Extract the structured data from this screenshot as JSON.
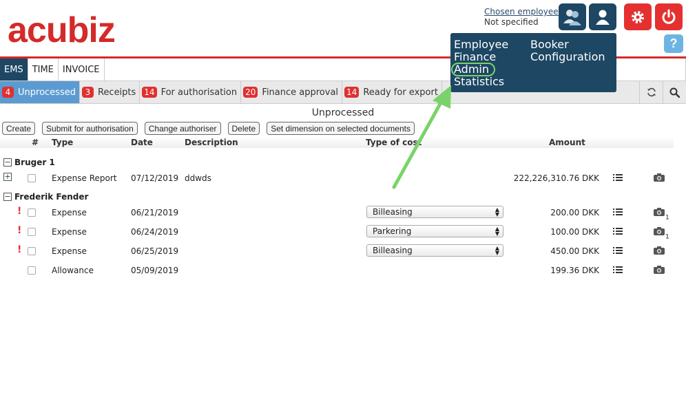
{
  "header": {
    "logo": "acubiz",
    "chosen_employee_label": "Chosen employee:",
    "chosen_employee_value": "Not specified",
    "help_label": "?"
  },
  "modules": [
    {
      "label": "EMS",
      "active": true
    },
    {
      "label": "TIME",
      "active": false
    },
    {
      "label": "INVOICE",
      "active": false
    }
  ],
  "subtabs": [
    {
      "count": "4",
      "label": "Unprocessed",
      "active": true
    },
    {
      "count": "3",
      "label": "Receipts",
      "active": false
    },
    {
      "count": "14",
      "label": "For authorisation",
      "active": false
    },
    {
      "count": "20",
      "label": "Finance approval",
      "active": false
    },
    {
      "count": "14",
      "label": "Ready for export",
      "active": false
    }
  ],
  "section_title": "Unprocessed",
  "actions": [
    "Create",
    "Submit for authorisation",
    "Change authoriser",
    "Delete",
    "Set dimension on selected documents"
  ],
  "columns": {
    "num": "#",
    "type": "Type",
    "date": "Date",
    "description": "Description",
    "cost_type": "Type of cost",
    "amount": "Amount"
  },
  "groups": [
    {
      "name": "Bruger 1",
      "toggle": "−"
    },
    {
      "name": "Frederik Fender",
      "toggle": "−"
    }
  ],
  "rows": [
    {
      "type": "Expense Report",
      "date": "07/12/2019",
      "description": "ddwds",
      "cost": "",
      "amount": "222,226,310.76 DKK",
      "warn": "",
      "expand": "+",
      "cam_count": ""
    },
    {
      "type": "Expense",
      "date": "06/21/2019",
      "description": "",
      "cost": "Billeasing",
      "amount": "200.00 DKK",
      "warn": "!",
      "cam_count": "1"
    },
    {
      "type": "Expense",
      "date": "06/24/2019",
      "description": "",
      "cost": "Parkering",
      "amount": "100.00 DKK",
      "warn": "!",
      "cam_count": "1"
    },
    {
      "type": "Expense",
      "date": "06/25/2019",
      "description": "",
      "cost": "Billeasing",
      "amount": "450.00 DKK",
      "warn": "!",
      "cam_count": ""
    },
    {
      "type": "Allowance",
      "date": "05/09/2019",
      "description": "",
      "cost": "",
      "amount": "199.36 DKK",
      "warn": "",
      "cam_count": ""
    }
  ],
  "dropdown_menu": {
    "col1": [
      "Employee",
      "Finance",
      "Admin",
      "Statistics"
    ],
    "col2": [
      "Booker",
      "Configuration"
    ]
  },
  "colors": {
    "brand": "#d42a2a",
    "nav": "#1d4763",
    "active_tab": "#5b9bd1",
    "badge": "#e03030",
    "annotation": "#7ad36a"
  }
}
